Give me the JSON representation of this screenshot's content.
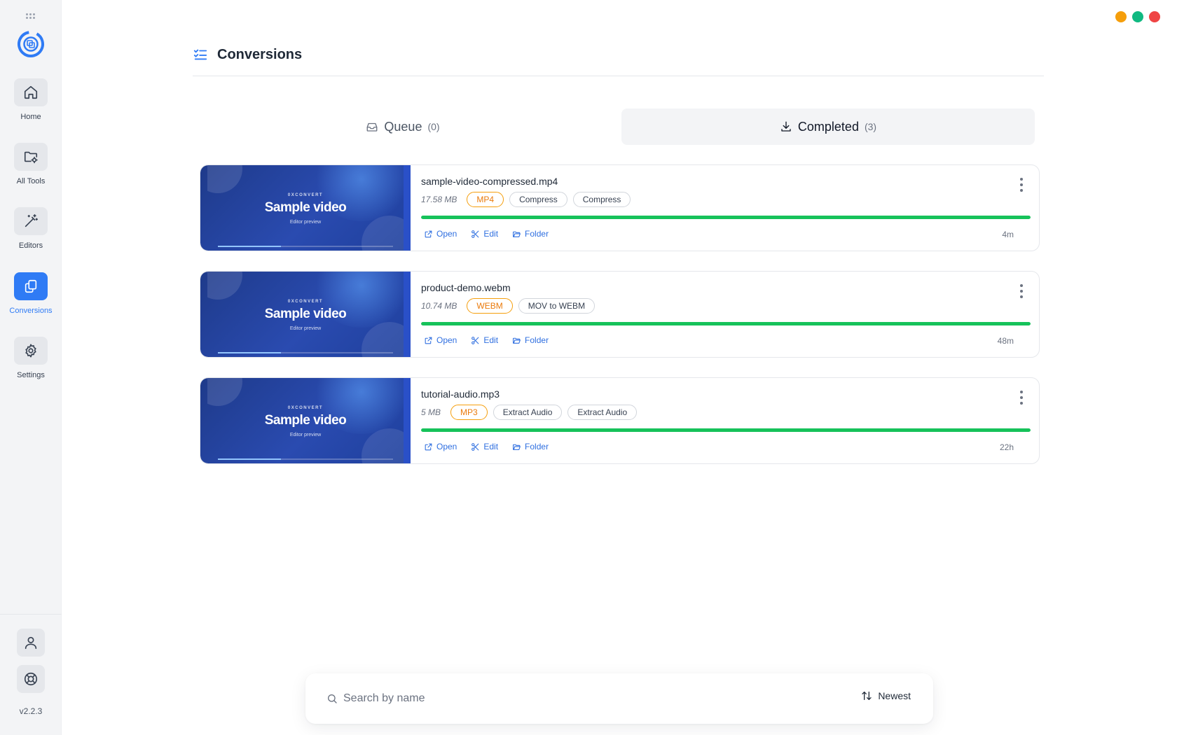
{
  "app": {
    "version": "v2.2.3",
    "logo_icon": "app-logo-icon",
    "accent_color": "#2f7bf5",
    "window_controls": [
      {
        "name": "minimize",
        "color": "#f59e0b"
      },
      {
        "name": "maximize",
        "color": "#10b981"
      },
      {
        "name": "close",
        "color": "#ef4444"
      }
    ]
  },
  "sidebar": {
    "items": [
      {
        "label": "Home",
        "icon": "home-icon",
        "active": false
      },
      {
        "label": "All Tools",
        "icon": "folder-gear-icon",
        "active": false
      },
      {
        "label": "Editors",
        "icon": "magic-wand-icon",
        "active": false
      },
      {
        "label": "Conversions",
        "icon": "copy-files-icon",
        "active": true
      },
      {
        "label": "Settings",
        "icon": "gear-icon",
        "active": false
      }
    ],
    "footer": [
      {
        "icon": "user-icon"
      },
      {
        "icon": "help-lifebuoy-icon"
      }
    ]
  },
  "header": {
    "title": "Conversions",
    "icon": "checklist-icon"
  },
  "tabs": [
    {
      "label": "Queue",
      "count": "(0)",
      "icon": "inbox-icon",
      "active": false
    },
    {
      "label": "Completed",
      "count": "(3)",
      "icon": "download-icon",
      "active": true
    }
  ],
  "thumbnail": {
    "brand": "0XCONVERT",
    "title": "Sample video",
    "subtitle": "Editor preview",
    "playback_progress": 0.36
  },
  "conversions": [
    {
      "file_name": "sample-video-compressed.mp4",
      "size": "17.58 MB",
      "format": "MP4",
      "tags": [
        "Compress",
        "Compress"
      ],
      "progress": 100,
      "elapsed": "4m"
    },
    {
      "file_name": "product-demo.webm",
      "size": "10.74 MB",
      "format": "WEBM",
      "tags": [
        "MOV to WEBM"
      ],
      "progress": 100,
      "elapsed": "48m"
    },
    {
      "file_name": "tutorial-audio.mp3",
      "size": "5 MB",
      "format": "MP3",
      "tags": [
        "Extract Audio",
        "Extract Audio"
      ],
      "progress": 100,
      "elapsed": "22h"
    }
  ],
  "card_actions": [
    {
      "label": "Open",
      "icon": "external-link-icon"
    },
    {
      "label": "Edit",
      "icon": "scissors-icon"
    },
    {
      "label": "Folder",
      "icon": "folder-open-icon"
    }
  ],
  "search": {
    "placeholder": "Search by name",
    "value": "",
    "sort_label": "Newest",
    "sort_icon": "sort-arrows-icon"
  }
}
